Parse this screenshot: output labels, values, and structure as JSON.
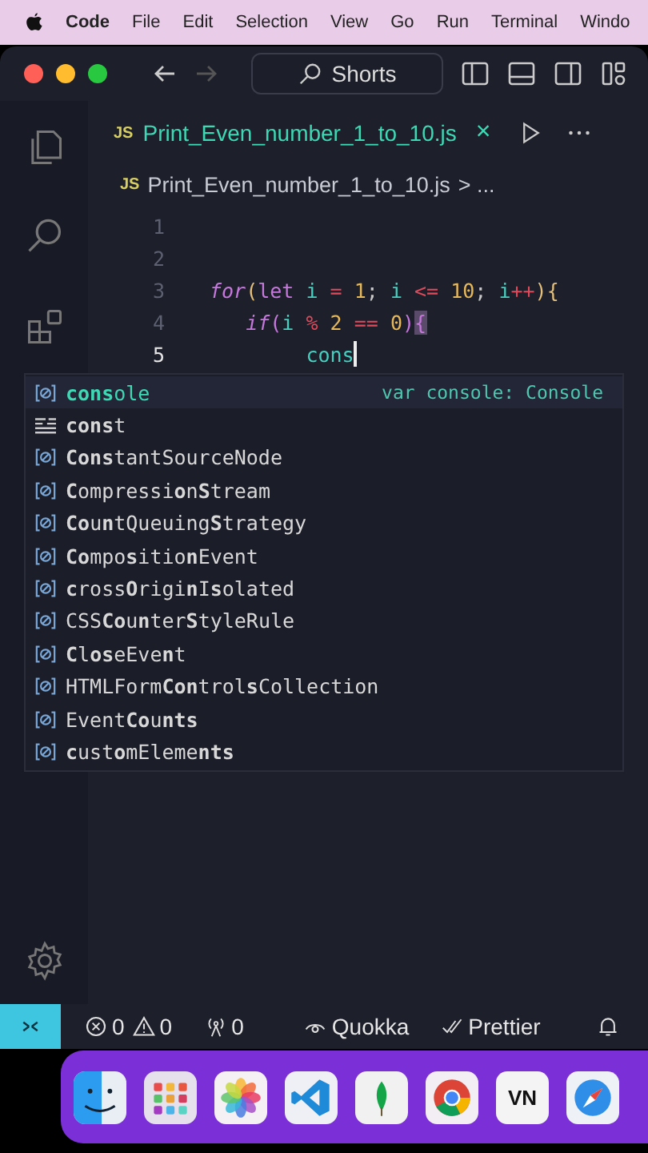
{
  "menu_bar": {
    "app": "Code",
    "items": [
      "File",
      "Edit",
      "Selection",
      "View",
      "Go",
      "Run",
      "Terminal",
      "Windo"
    ]
  },
  "title_bar": {
    "search": "Shorts"
  },
  "tab": {
    "badge": "JS",
    "label": "Print_Even_number_1_to_10.js",
    "close": "×"
  },
  "breadcrumb": {
    "badge": "JS",
    "file": "Print_Even_number_1_to_10.js",
    "more": "> ..."
  },
  "editor": {
    "lines": [
      {
        "number": "1",
        "cursor": false
      },
      {
        "number": "2",
        "cursor": false
      },
      {
        "number": "3",
        "cursor": false,
        "tokens": [
          {
            "kind": "keyword",
            "text": "for"
          },
          {
            "kind": "bracket",
            "text": "("
          },
          {
            "kind": "storage",
            "text": "let "
          },
          {
            "kind": "ident",
            "text": "i "
          },
          {
            "kind": "op",
            "text": "= "
          },
          {
            "kind": "num",
            "text": "1"
          },
          {
            "kind": "punct",
            "text": "; "
          },
          {
            "kind": "ident",
            "text": "i "
          },
          {
            "kind": "op",
            "text": "<= "
          },
          {
            "kind": "num",
            "text": "10"
          },
          {
            "kind": "punct",
            "text": "; "
          },
          {
            "kind": "ident",
            "text": "i"
          },
          {
            "kind": "op",
            "text": "++"
          },
          {
            "kind": "bracket",
            "text": "){"
          }
        ]
      },
      {
        "number": "4",
        "cursor": false,
        "tokens": [
          {
            "kind": "keyword",
            "text": "   if"
          },
          {
            "kind": "bracket2",
            "text": "("
          },
          {
            "kind": "ident",
            "text": "i "
          },
          {
            "kind": "op",
            "text": "% "
          },
          {
            "kind": "num",
            "text": "2 "
          },
          {
            "kind": "op",
            "text": "== "
          },
          {
            "kind": "num",
            "text": "0"
          },
          {
            "kind": "bracket2",
            "text": ")"
          },
          {
            "kind": "match",
            "text": "{"
          }
        ]
      },
      {
        "number": "5",
        "cursor": true,
        "tokens": [
          {
            "kind": "ident",
            "text": "        cons"
          }
        ]
      }
    ]
  },
  "suggestions": [
    {
      "kind": "variable",
      "label": "**cons**ole",
      "detail": "var console: Console",
      "selected": true
    },
    {
      "kind": "keyword",
      "label": "**cons**t",
      "selected": false
    },
    {
      "kind": "variable",
      "label": "**Cons**tantSourceNode",
      "selected": false
    },
    {
      "kind": "variable",
      "label": "**C**ompressi**o**n**S**tream",
      "selected": false
    },
    {
      "kind": "variable",
      "label": "**Co**u**n**tQueuing**S**trategy",
      "selected": false
    },
    {
      "kind": "variable",
      "label": "**Co**mpo**s**itio**n**Event",
      "selected": false
    },
    {
      "kind": "variable",
      "label": "**c**ross**O**rigi**n**I**s**olated",
      "selected": false
    },
    {
      "kind": "variable",
      "label": "CSS**Co**u**n**ter**S**tyleRule",
      "selected": false
    },
    {
      "kind": "variable",
      "label": "**C**l**os**eEve**n**t",
      "selected": false
    },
    {
      "kind": "variable",
      "label": "HTMLForm**Con**trol**s**Collection",
      "selected": false
    },
    {
      "kind": "variable",
      "label": "Event**Co**u**nts**",
      "selected": false
    },
    {
      "kind": "variable",
      "label": "**c**ust**o**mEleme**nts**",
      "selected": false
    }
  ],
  "status_bar": {
    "errors": "0",
    "warnings": "0",
    "ports": "0",
    "quokka": "Quokka",
    "prettier": "Prettier"
  },
  "dock": [
    {
      "kind": "finder"
    },
    {
      "kind": "launchpad"
    },
    {
      "kind": "photos"
    },
    {
      "kind": "vscode"
    },
    {
      "kind": "mongo"
    },
    {
      "kind": "chrome"
    },
    {
      "kind": "text",
      "text": "VN"
    },
    {
      "kind": "safari"
    }
  ]
}
